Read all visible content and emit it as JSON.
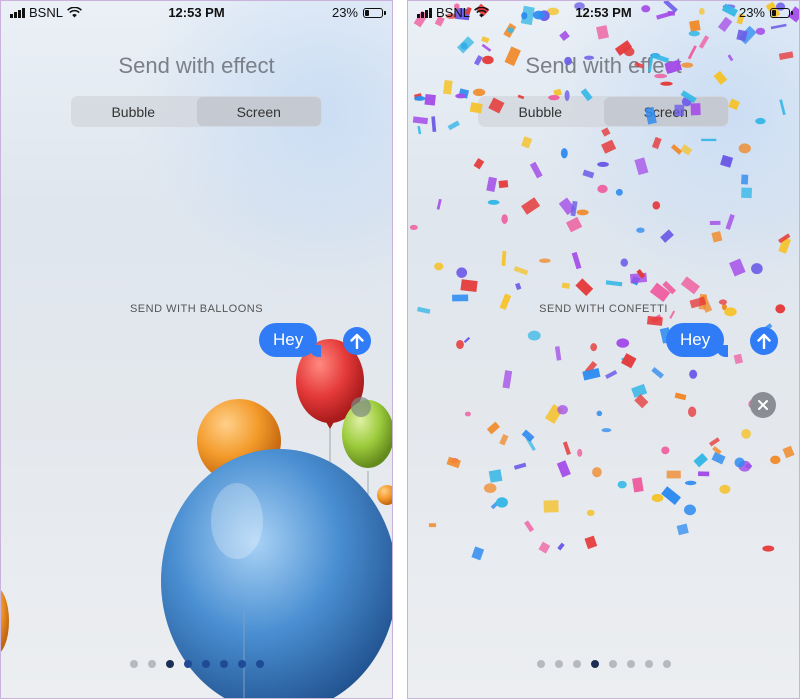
{
  "screens": [
    {
      "status": {
        "carrier": "BSNL",
        "time": "12:53 PM",
        "battery": "23%"
      },
      "title": "Send with effect",
      "tabs": [
        {
          "label": "Bubble",
          "selected": false
        },
        {
          "label": "Screen",
          "selected": true
        }
      ],
      "effect_label": "SEND WITH BALLOONS",
      "message": "Hey",
      "page_dots": {
        "count": 8,
        "current_index": 2
      },
      "icons": [
        "wifi-icon",
        "signal-icon",
        "battery-icon",
        "send-arrow-icon",
        "balloon"
      ]
    },
    {
      "status": {
        "carrier": "BSNL",
        "time": "12:53 PM",
        "battery": "23%"
      },
      "title": "Send with effect",
      "tabs": [
        {
          "label": "Bubble",
          "selected": false
        },
        {
          "label": "Screen",
          "selected": true
        }
      ],
      "effect_label": "SEND WITH CONFETTI",
      "message": "Hey",
      "page_dots": {
        "count": 8,
        "current_index": 3
      },
      "icons": [
        "wifi-icon",
        "signal-icon",
        "battery-icon",
        "send-arrow-icon",
        "close-icon",
        "confetti"
      ]
    }
  ],
  "colors": {
    "accent": "#2f7cf6",
    "balloons": [
      "#e53a3a",
      "#f39a2a",
      "#9ccb3c",
      "#3d7fc4"
    ],
    "confetti": [
      "#e53a3a",
      "#2f8cf0",
      "#f5c22b",
      "#a44ee8",
      "#ef5fa0",
      "#39b8e6",
      "#f08a2a",
      "#6c5ce7"
    ]
  }
}
